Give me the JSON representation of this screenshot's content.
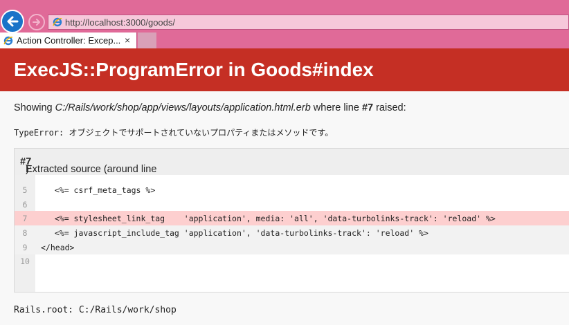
{
  "browser": {
    "url": "http://localhost:3000/goods/",
    "tab_title": "Action Controller: Excep...",
    "tab_close": "×"
  },
  "page": {
    "title": "ExecJS::ProgramError in Goods#index",
    "showing_prefix": "Showing ",
    "template_path": "C:/Rails/work/shop/app/views/layouts/application.html.erb",
    "where_line": " where line ",
    "line_ref": "#7",
    "raised": " raised:",
    "error_type": "TypeError:",
    "error_message": "オブジェクトでサポートされていないプロパティまたはメソッドです。",
    "extracted_prefix": "Extracted source (around line ",
    "extracted_line": "#7",
    "extracted_suffix": "):",
    "rails_root": "Rails.root: C:/Rails/work/shop"
  },
  "source_lines": [
    {
      "num": "5",
      "code": "  <%= csrf_meta_tags %>"
    },
    {
      "num": "6",
      "code": ""
    },
    {
      "num": "7",
      "code": "  <%= stylesheet_link_tag    'application', media: 'all', 'data-turbolinks-track': 'reload' %>"
    },
    {
      "num": "8",
      "code": "  <%= javascript_include_tag 'application', 'data-turbolinks-track': 'reload' %>"
    },
    {
      "num": "9",
      "code": "</head>"
    },
    {
      "num": "10",
      "code": ""
    }
  ],
  "colors": {
    "browser_chrome": "#e06a98",
    "header_red": "#c52f24",
    "highlight_line": "#fdcfcf"
  }
}
